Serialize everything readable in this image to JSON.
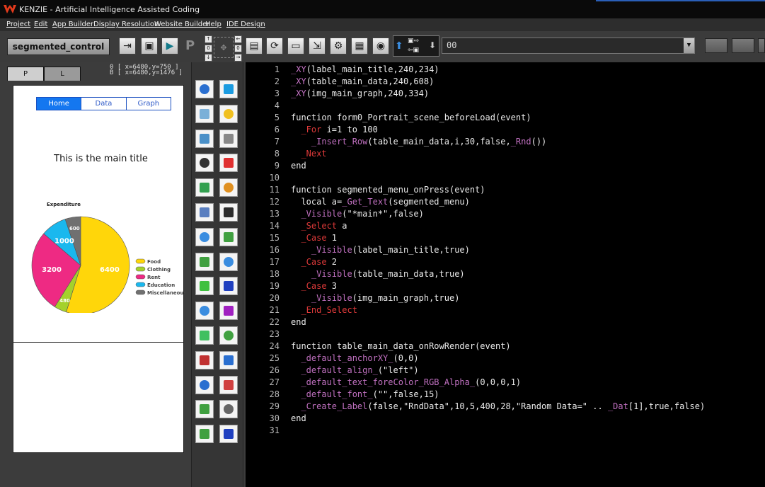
{
  "window": {
    "title": "KENZIE - Artificial Intelligence Assisted Coding"
  },
  "menu": [
    "Project",
    "Edit",
    "App Builder",
    "Display Resolution",
    "Website Builder",
    "Help",
    "IDE Design"
  ],
  "toolbar": {
    "project_name": "segmented_control",
    "value_field": "00",
    "p_label": "P",
    "nudge": {
      "up": "↑",
      "down": "↓",
      "left": "←",
      "right": "→",
      "zero1": "0",
      "zero2": "0"
    }
  },
  "left_panel": {
    "tabs": [
      "P",
      "L"
    ],
    "coords": [
      "0 [ x=6480,y=750 ]",
      "B [ x=6480,y=1476 ]"
    ],
    "preview": {
      "segments": [
        "Home",
        "Data",
        "Graph"
      ],
      "main_title": "This is the main title",
      "chart_data": {
        "type": "pie",
        "title": "Expenditure",
        "categories": [
          "Food",
          "Clothing",
          "Rent",
          "Education",
          "Miscellaneous"
        ],
        "values": [
          6400,
          480,
          3200,
          1000,
          600
        ],
        "colors": [
          "#ffd60a",
          "#a4d12c",
          "#ee2a83",
          "#1ab8ee",
          "#707070"
        ],
        "legend": "right"
      }
    }
  },
  "palette_icons": [
    "label-icon",
    "text-icon",
    "image-icon",
    "button-icon",
    "image-button-icon",
    "rotate-icon",
    "table-icon",
    "layers-icon",
    "progress-icon",
    "container-icon",
    "text-area-icon",
    "align-icon",
    "input-icon",
    "node-icon",
    "slider-icon",
    "tree-icon",
    "spinner-icon",
    "resize-icon",
    "stepper-icon",
    "link-icon",
    "toggle-icon",
    "connect-icon",
    "html-icon",
    "web-icon",
    "browser-icon",
    "list-icon",
    "radio-icon",
    "clock-icon",
    "checkbox-icon",
    "video-icon"
  ],
  "editor": {
    "lines": [
      "_XY(label_main_title,240,234)",
      "_XY(table_main_data,240,608)",
      "_XY(img_main_graph,240,334)",
      "",
      "function form0_Portrait_scene_beforeLoad(event)",
      "  _For i=1 to 100",
      "    _Insert_Row(table_main_data,i,30,false,_Rnd())",
      "  _Next",
      "end",
      "",
      "function segmented_menu_onPress(event)",
      "  local a=_Get_Text(segmented_menu)",
      "  _Visible(\"*main*\",false)",
      "  _Select a",
      "  _Case 1",
      "    _Visible(label_main_title,true)",
      "  _Case 2",
      "    _Visible(table_main_data,true)",
      "  _Case 3",
      "    _Visible(img_main_graph,true)",
      "  _End_Select",
      "end",
      "",
      "function table_main_data_onRowRender(event)",
      "  _default_anchorXY_(0,0)",
      "  _default_align_(\"left\")",
      "  _default_text_foreColor_RGB_Alpha_(0,0,0,1)",
      "  _default_font_(\"\",false,15)",
      "  _Create_Label(false,\"RndData\",10,5,400,28,\"Random Data=\" .. _Dat[1],true,false)",
      "end",
      ""
    ]
  }
}
